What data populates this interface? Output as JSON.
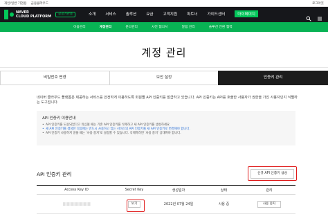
{
  "topbar": {
    "links": [
      "개인/일반 기업용",
      "금융클라우드"
    ],
    "right": "로그아웃"
  },
  "header": {
    "brand_line1": "NAVER",
    "brand_line2": "CLOUD PLATFORM",
    "badge": "공공기관용",
    "menu": [
      "소개",
      "서비스",
      "솔루션",
      "요금",
      "고객지원",
      "파트너",
      "가이드센터",
      "마이페이지"
    ],
    "active_menu": "마이페이지"
  },
  "subnav": {
    "items": [
      "이용관리",
      "계정관리",
      "문의관리",
      "사전 협의서",
      "알림 관리",
      "솔루션 전환 협력"
    ],
    "current": "계정관리"
  },
  "page_title": "계정 관리",
  "tabs": [
    {
      "label": "비밀번호 변경",
      "active": false
    },
    {
      "label": "보안 설정",
      "active": false
    },
    {
      "label": "인증키 관리",
      "active": true
    }
  ],
  "description": "네이버 클라우드 플랫폼은 제공하는 서비스를 안전하게 이용하도록 회원별 API 인증키를 발급하고 있습니다. API 인증키는 API를 호출한 사용자가 권한을 가진 사용자인지 식별하는 도구입니다.",
  "guide": {
    "title": "API 인증키 이용안내",
    "items": [
      {
        "text": "API 인증키를 도용되었다고 의심될 때는 기존 API 인증키를 삭제하고 새 API 인증키를 생성하세요.",
        "highlight": false
      },
      {
        "text": "새 API 인증키를 생성한 다음에는 반드시 사용하고 있는 서비스의 API 인증키를 새 API 인증키로 변경해야 합니다.",
        "highlight": true
      },
      {
        "text": "API 인증키 사용하지 않을 때는 '사용 중지'로 설정할 수 있습니다. 삭제하려면 '사용 중지' 상태여야 합니다.",
        "highlight": false
      }
    ]
  },
  "api_section": {
    "title": "API 인증키 관리",
    "new_key_button": "신규 API 인증키 생성",
    "columns": [
      "Access Key ID",
      "Secret Key",
      "생성일자",
      "상태",
      "관리"
    ],
    "rows": [
      {
        "secret_button": "보기",
        "created": "2022년 07월 24일",
        "status": "사용 중",
        "action": "사용 중지"
      }
    ]
  },
  "colors": {
    "accent": "#03c75a",
    "navbar": "#16171b",
    "highlight": "#e01b1b"
  }
}
